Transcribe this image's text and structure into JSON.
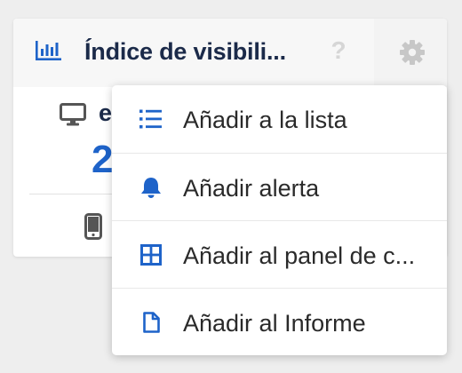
{
  "widget": {
    "title": "Índice de visibili...",
    "help_symbol": "?",
    "desktop_label": "e",
    "desktop_value": "2",
    "icons": [
      "bar-chart-icon",
      "help-icon",
      "gear-icon",
      "desktop-icon",
      "mobile-icon"
    ]
  },
  "menu": {
    "items": [
      {
        "label": "Añadir a la lista",
        "icon": "list-icon"
      },
      {
        "label": "Añadir alerta",
        "icon": "bell-icon"
      },
      {
        "label": "Añadir al panel de c...",
        "icon": "grid-icon"
      },
      {
        "label": "Añadir al Informe",
        "icon": "document-icon"
      }
    ]
  },
  "colors": {
    "accent": "#1e63c9",
    "title": "#1b2a49",
    "background": "#eeeeee"
  }
}
